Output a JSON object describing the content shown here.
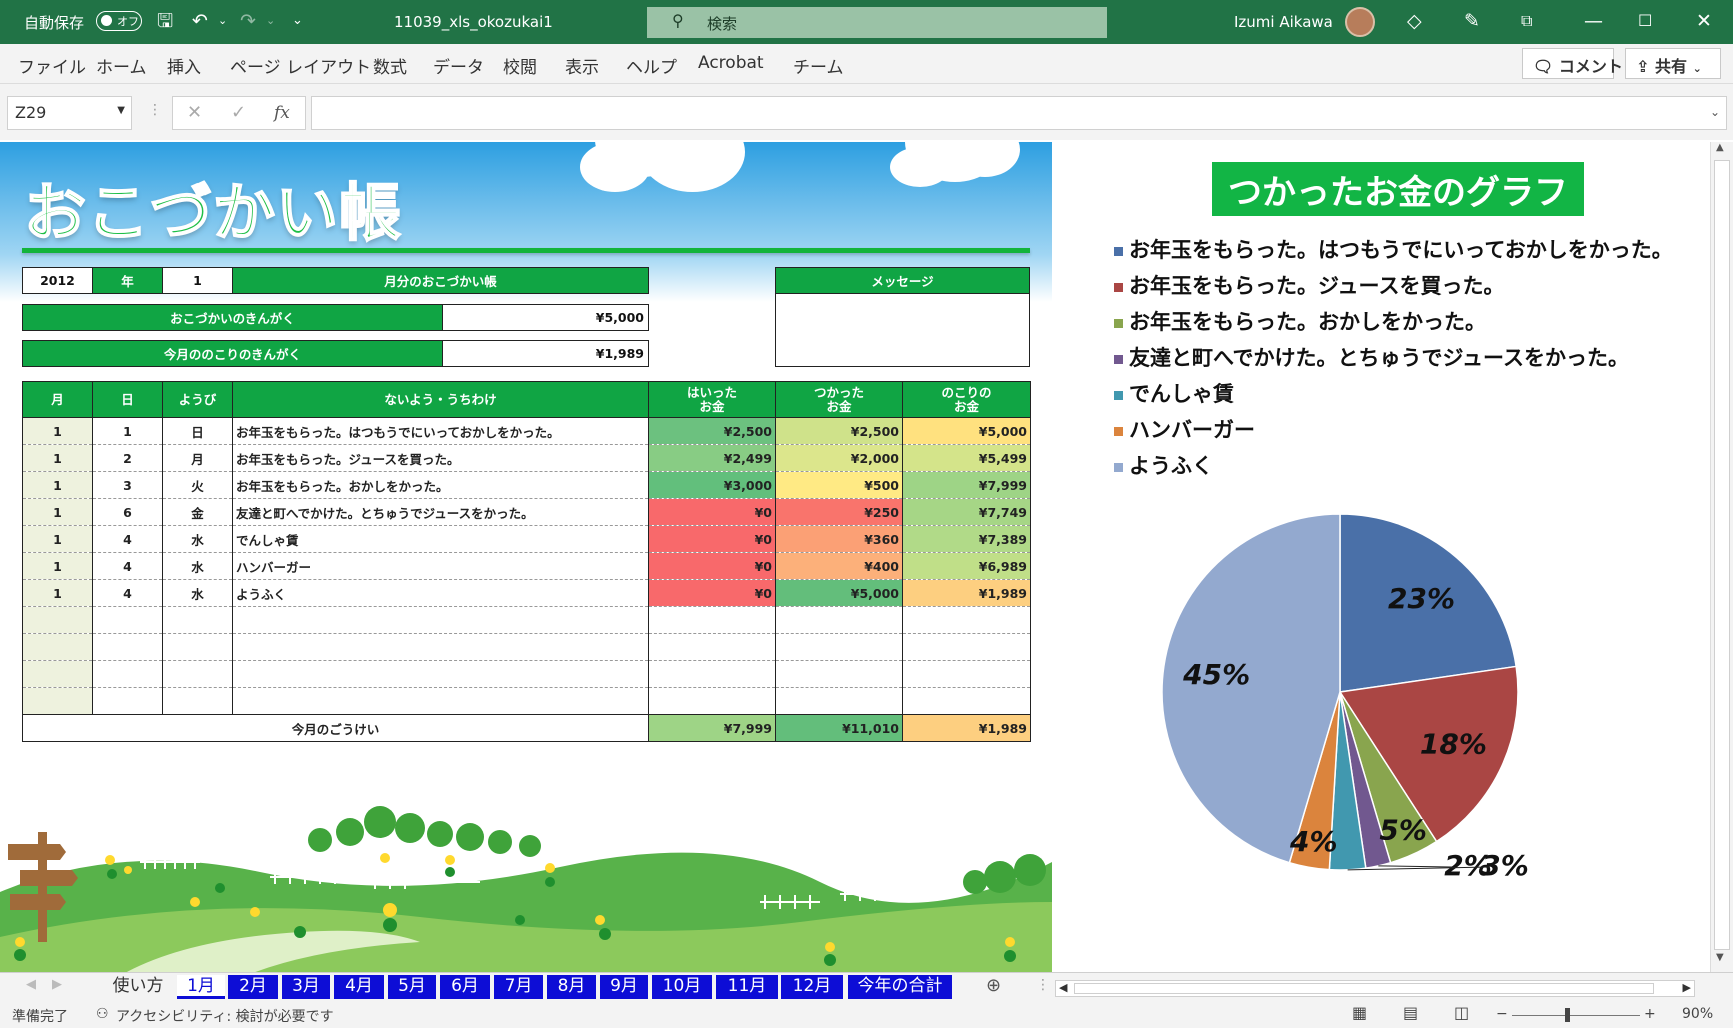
{
  "titlebar": {
    "autosave_label": "自動保存",
    "autosave_state": "オフ",
    "filename": "11039_xls_okozukai1",
    "search_placeholder": "検索",
    "user_name": "Izumi Aikawa"
  },
  "menu": {
    "items": [
      "ファイル",
      "ホーム",
      "挿入",
      "ページ レイアウト",
      "数式",
      "データ",
      "校閲",
      "表示",
      "ヘルプ",
      "Acrobat",
      "チーム"
    ],
    "comment_label": "コメント",
    "share_label": "共有"
  },
  "formula": {
    "name_box": "Z29",
    "fx_label": "fx",
    "content": ""
  },
  "sheet": {
    "title": "おこづかい帳",
    "year": "2012",
    "year_label": "年",
    "month": "1",
    "month_label": "月分のおこづかい帳",
    "message_label": "メッセージ",
    "message_text": "",
    "allowance_label": "おこづかいのきんがく",
    "allowance_value": "¥5,000",
    "remaining_label": "今月ののこりのきんがく",
    "remaining_value": "¥1,989",
    "table": {
      "headers": [
        "月",
        "日",
        "ようび",
        "ないよう・うちわけ",
        "はいった\nお金",
        "つかった\nお金",
        "のこりの\nお金"
      ],
      "rows": [
        {
          "m": "1",
          "d": "1",
          "w": "日",
          "desc": "お年玉をもらった。はつもうでにいっておかしをかった。",
          "in": "¥2,500",
          "out": "¥2,500",
          "rest": "¥5,000",
          "in_color": "#6cc17f",
          "out_color": "#cfe28a",
          "rest_color": "#ffe17f"
        },
        {
          "m": "1",
          "d": "2",
          "w": "月",
          "desc": "お年玉をもらった。ジュースを買った。",
          "in": "¥2,499",
          "out": "¥2,000",
          "rest": "¥5,499",
          "in_color": "#88cc84",
          "out_color": "#dce68c",
          "rest_color": "#d4e48a"
        },
        {
          "m": "1",
          "d": "3",
          "w": "火",
          "desc": "お年玉をもらった。おかしをかった。",
          "in": "¥3,000",
          "out": "¥500",
          "rest": "¥7,999",
          "in_color": "#62bf7c",
          "out_color": "#ffea84",
          "rest_color": "#9ed486"
        },
        {
          "m": "1",
          "d": "6",
          "w": "金",
          "desc": "友達と町へでかけた。とちゅうでジュースをかった。",
          "in": "¥0",
          "out": "¥250",
          "rest": "¥7,749",
          "in_color": "#f8696b",
          "out_color": "#f9746c",
          "rest_color": "#a6d686"
        },
        {
          "m": "1",
          "d": "4",
          "w": "水",
          "desc": "でんしゃ賃",
          "in": "¥0",
          "out": "¥360",
          "rest": "¥7,389",
          "in_color": "#f8696b",
          "out_color": "#fba075",
          "rest_color": "#b1da88"
        },
        {
          "m": "1",
          "d": "4",
          "w": "水",
          "desc": "ハンバーガー",
          "in": "¥0",
          "out": "¥400",
          "rest": "¥6,989",
          "in_color": "#f8696b",
          "out_color": "#fcb07a",
          "rest_color": "#c0df88"
        },
        {
          "m": "1",
          "d": "4",
          "w": "水",
          "desc": "ようふく",
          "in": "¥0",
          "out": "¥5,000",
          "rest": "¥1,989",
          "in_color": "#f8696b",
          "out_color": "#63be7b",
          "rest_color": "#fdcf80"
        }
      ],
      "total_label": "今月のごうけい",
      "total_in": "¥7,999",
      "total_out": "¥11,010",
      "total_rest": "¥1,989"
    }
  },
  "chart_data": {
    "type": "pie",
    "title": "つかったお金のグラフ",
    "legend_position": "top",
    "categories": [
      "お年玉をもらった。はつもうでにいっておかしをかった。",
      "お年玉をもらった。ジュースを買った。",
      "お年玉をもらった。おかしをかった。",
      "友達と町へでかけた。とちゅうでジュースをかった。",
      "でんしゃ賃",
      "ハンバーガー",
      "ようふく"
    ],
    "values": [
      2500,
      2000,
      500,
      250,
      360,
      400,
      5000
    ],
    "labels": [
      "23%",
      "18%",
      "5%",
      "2%",
      "3%",
      "4%",
      "45%"
    ],
    "colors": [
      "#4a70a8",
      "#aa4644",
      "#89a54e",
      "#71588f",
      "#4198af",
      "#db843d",
      "#93a9cf"
    ]
  },
  "tabs": [
    "使い方",
    "1月",
    "2月",
    "3月",
    "4月",
    "5月",
    "6月",
    "7月",
    "8月",
    "9月",
    "10月",
    "11月",
    "12月",
    "今年の合計"
  ],
  "status": {
    "ready": "準備完了",
    "accessibility": "アクセシビリティ: 検討が必要です",
    "zoom": "90%"
  }
}
